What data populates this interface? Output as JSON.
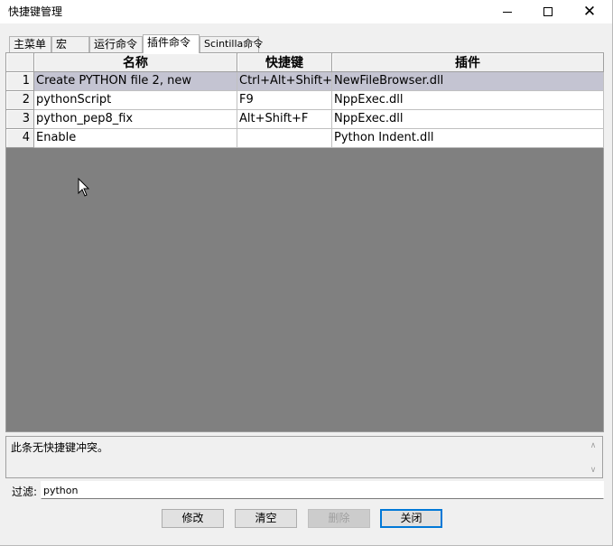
{
  "window": {
    "title": "快捷键管理"
  },
  "tabs": [
    {
      "label": "主菜单",
      "active": false
    },
    {
      "label": "宏",
      "active": false
    },
    {
      "label": "运行命令",
      "active": false
    },
    {
      "label": "插件命令",
      "active": true
    },
    {
      "label": "Scintilla命令",
      "active": false
    }
  ],
  "grid": {
    "columns": [
      "名称",
      "快捷键",
      "插件"
    ],
    "rows": [
      {
        "num": "1",
        "name": "Create PYTHON file 2, new",
        "shortcut": "Ctrl+Alt+Shift+N",
        "plugin": "NewFileBrowser.dll",
        "selected": true
      },
      {
        "num": "2",
        "name": "pythonScript",
        "shortcut": "F9",
        "plugin": "NppExec.dll",
        "selected": false
      },
      {
        "num": "3",
        "name": "python_pep8_fix",
        "shortcut": "Alt+Shift+F",
        "plugin": "NppExec.dll",
        "selected": false
      },
      {
        "num": "4",
        "name": "Enable",
        "shortcut": "",
        "plugin": "Python Indent.dll",
        "selected": false
      }
    ]
  },
  "conflict_info": "此条无快捷键冲突。",
  "filter": {
    "label": "过滤:",
    "value": "python"
  },
  "buttons": {
    "modify": "修改",
    "clear": "清空",
    "delete": "删除",
    "close": "关闭"
  },
  "colors": {
    "selected_row": "#c4c4d2",
    "grid_background": "#808080",
    "default_button_border": "#0078d7"
  }
}
